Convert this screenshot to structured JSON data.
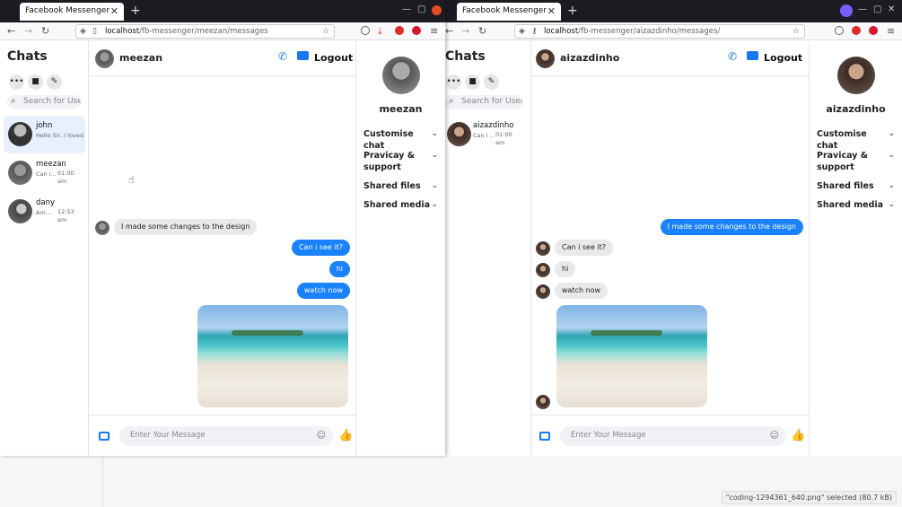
{
  "left_window": {
    "tab_title": "Facebook Messenger",
    "url_host": "localhost",
    "url_path": "/fb-messenger/meezan/messages",
    "sidebar": {
      "title": "Chats",
      "search_placeholder": "Search for User",
      "contacts": [
        {
          "name": "john",
          "preview": "Hello Sir, I loved y",
          "time": ""
        },
        {
          "name": "meezan",
          "preview": "Can i...",
          "time": "01:00 am"
        },
        {
          "name": "dany",
          "preview": "Am...",
          "time": "12:53 am"
        }
      ]
    },
    "chat": {
      "name": "meezan",
      "logout_label": "Logout",
      "messages": [
        {
          "dir": "in",
          "text": "I made some changes to the design"
        },
        {
          "dir": "out",
          "text": "Can i see it?"
        },
        {
          "dir": "out",
          "text": "hi"
        },
        {
          "dir": "out",
          "text": "watch now"
        }
      ],
      "composer_placeholder": "Enter Your Message"
    },
    "info": {
      "name": "meezan",
      "sections": [
        "Customise chat",
        "Pravicay & support",
        "Shared files",
        "Shared media"
      ]
    }
  },
  "right_window": {
    "tab_title": "Facebook Messenger",
    "url_host": "localhost",
    "url_path": "/fb-messenger/aizazdinho/messages/",
    "sidebar": {
      "title": "Chats",
      "search_placeholder": "Search for User",
      "contacts": [
        {
          "name": "aizazdinho",
          "preview": "Can i ...",
          "time": "01:00 am"
        }
      ]
    },
    "chat": {
      "name": "aizazdinho",
      "logout_label": "Logout",
      "messages": [
        {
          "dir": "out",
          "text": "I made some changes to the design"
        },
        {
          "dir": "in",
          "text": "Can i see it?"
        },
        {
          "dir": "in",
          "text": "hi"
        },
        {
          "dir": "in",
          "text": "watch now"
        }
      ],
      "composer_placeholder": "Enter Your Message"
    },
    "info": {
      "name": "aizazdinho",
      "sections": [
        "Customise chat",
        "Pravicay & support",
        "Shared files",
        "Shared media"
      ]
    }
  },
  "statusbar": "\"coding-1294361_640.png\" selected (80.7 kB)",
  "icons": {
    "more": "ellipsis-icon",
    "video": "video-icon",
    "compose": "compose-icon",
    "search": "search-icon",
    "phone": "phone-icon",
    "gallery": "gallery-icon",
    "emoji": "emoji-icon",
    "like": "thumbs-up-icon"
  },
  "colors": {
    "accent": "#1877f2",
    "out_bubble": "#1a82ff",
    "in_bubble": "#e9e9eb",
    "browser_chrome": "#1c1b22"
  }
}
